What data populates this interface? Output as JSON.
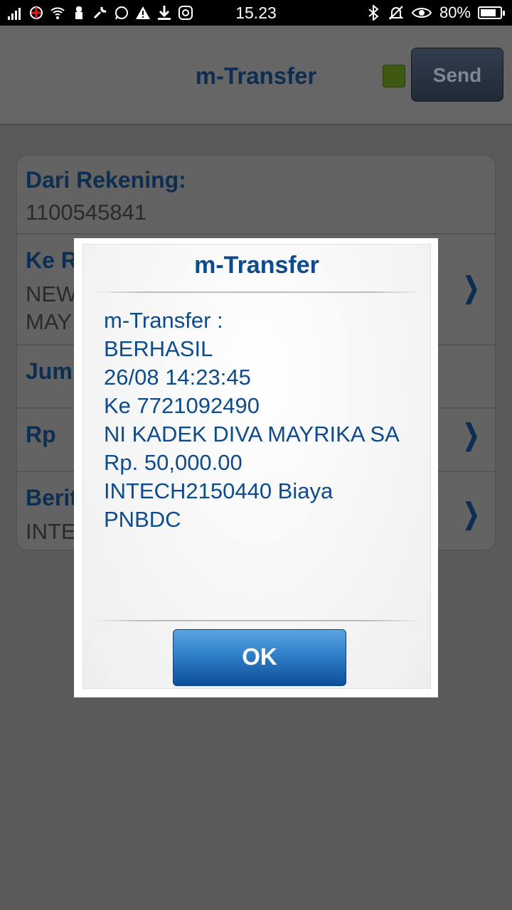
{
  "status_bar": {
    "time": "15.23",
    "battery": "80%",
    "battery_level": 0.8,
    "left_icons": [
      "signal-icon",
      "network-icon",
      "wifi-icon",
      "usb-icon",
      "wrench-icon",
      "whatsapp-icon",
      "warning-icon",
      "download-icon",
      "instagram-icon"
    ],
    "right_icons": [
      "bluetooth-icon",
      "bell-muted-icon",
      "eye-icon",
      "battery-icon"
    ]
  },
  "header": {
    "title": "m-Transfer",
    "send_label": "Send",
    "status_color": "#6aa020"
  },
  "form": {
    "rows": [
      {
        "label": "Dari Rekening:",
        "value": "1100545841"
      },
      {
        "label": "Ke R",
        "value": "NEW",
        "value2": "MAY"
      },
      {
        "label": "Jum",
        "value": ""
      },
      {
        "label": "Rp",
        "value": ""
      },
      {
        "label": "Berit",
        "value": "INTE"
      }
    ]
  },
  "dialog": {
    "title": "m-Transfer",
    "lines": [
      "m-Transfer :",
      "BERHASIL",
      "26/08 14:23:45",
      "Ke 7721092490",
      "NI KADEK DIVA MAYRIKA SA",
      "Rp. 50,000.00",
      "INTECH2150440 Biaya",
      "PNBDC"
    ],
    "ok_label": "OK"
  },
  "colors": {
    "accent": "#0d4b8c",
    "overlay": "#585858"
  }
}
